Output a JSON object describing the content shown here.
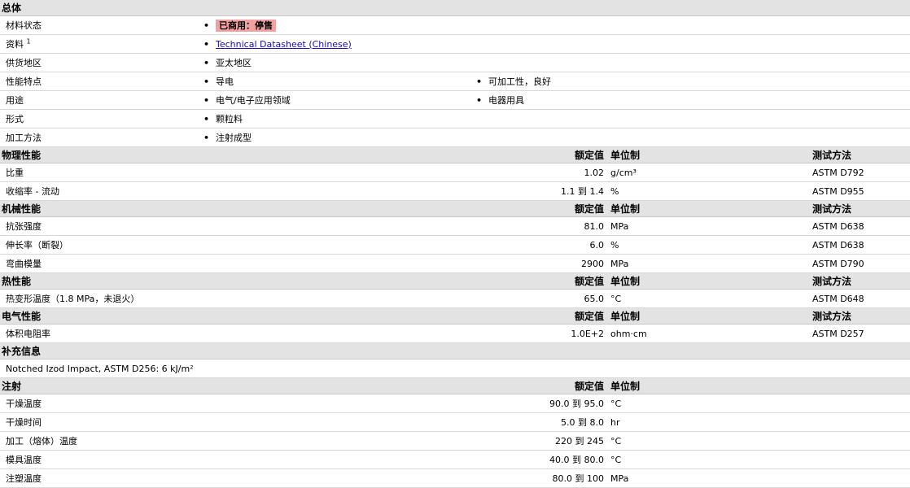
{
  "overall": {
    "header": "总体",
    "rows": [
      {
        "label": "材料状态",
        "values": [
          "已商用：停售"
        ]
      },
      {
        "label": "资料",
        "sup": "1",
        "values": [
          "Technical Datasheet (Chinese)"
        ]
      },
      {
        "label": "供货地区",
        "values": [
          "亚太地区"
        ]
      },
      {
        "label": "性能特点",
        "values": [
          "导电",
          "可加工性，良好"
        ]
      },
      {
        "label": "用途",
        "values": [
          "电气/电子应用领域",
          "电器用具"
        ]
      },
      {
        "label": "形式",
        "values": [
          "颗粒料"
        ]
      },
      {
        "label": "加工方法",
        "values": [
          "注射成型"
        ]
      }
    ]
  },
  "col_headers": {
    "nominal": "额定值",
    "unit": "单位制",
    "test": "测试方法"
  },
  "sections": [
    {
      "title": "物理性能",
      "rows": [
        {
          "label": "比重",
          "value": "1.02",
          "unit": "g/cm³",
          "test": "ASTM D792"
        },
        {
          "label": "收缩率 - 流动",
          "value": "1.1 到  1.4",
          "unit": "%",
          "test": "ASTM D955"
        }
      ]
    },
    {
      "title": "机械性能",
      "rows": [
        {
          "label": "抗张强度",
          "value": "81.0",
          "unit": "MPa",
          "test": "ASTM D638"
        },
        {
          "label": "伸长率（断裂）",
          "value": "6.0",
          "unit": "%",
          "test": "ASTM D638"
        },
        {
          "label": "弯曲模量",
          "value": "2900",
          "unit": "MPa",
          "test": "ASTM D790"
        }
      ]
    },
    {
      "title": "热性能",
      "rows": [
        {
          "label": "热变形温度（1.8 MPa，未退火）",
          "value": "65.0",
          "unit": "°C",
          "test": "ASTM D648"
        }
      ]
    },
    {
      "title": "电气性能",
      "rows": [
        {
          "label": "体积电阻率",
          "value": "1.0E+2",
          "unit": "ohm·cm",
          "test": "ASTM D257"
        }
      ]
    }
  ],
  "supplement": {
    "title": "补充信息",
    "text": "Notched Izod Impact, ASTM D256: 6 kJ/m²"
  },
  "injection": {
    "title": "注射",
    "rows": [
      {
        "label": "干燥温度",
        "value": "90.0 到  95.0",
        "unit": "°C"
      },
      {
        "label": "干燥时间",
        "value": "5.0 到  8.0",
        "unit": "hr"
      },
      {
        "label": "加工（熔体）温度",
        "value": "220 到  245",
        "unit": "°C"
      },
      {
        "label": "模具温度",
        "value": "40.0 到  80.0",
        "unit": "°C"
      },
      {
        "label": "注塑温度",
        "value": "80.0 到  100",
        "unit": "MPa"
      }
    ]
  }
}
